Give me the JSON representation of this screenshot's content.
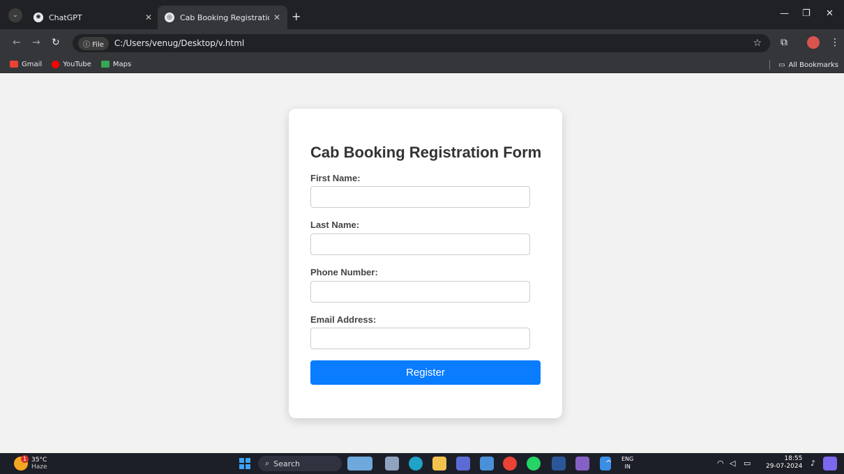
{
  "browser": {
    "tabs": [
      {
        "title": "ChatGPT",
        "favicon": "chatgpt-icon",
        "active": false
      },
      {
        "title": "Cab Booking Registration Form",
        "favicon": "globe-icon",
        "active": true
      }
    ],
    "file_chip": "File",
    "url": "C:/Users/venug/Desktop/v.html",
    "bookmarks": [
      {
        "label": "Gmail",
        "icon": "gmail-icon"
      },
      {
        "label": "YouTube",
        "icon": "youtube-icon"
      },
      {
        "label": "Maps",
        "icon": "maps-icon"
      }
    ],
    "all_bookmarks": "All Bookmarks"
  },
  "form": {
    "title": "Cab Booking Registration Form",
    "fields": [
      {
        "label": "First Name:",
        "value": ""
      },
      {
        "label": "Last Name:",
        "value": ""
      },
      {
        "label": "Phone Number:",
        "value": ""
      },
      {
        "label": "Email Address:",
        "value": ""
      }
    ],
    "submit_label": "Register",
    "accent": "#0a7cff"
  },
  "taskbar": {
    "weather_temp": "35°C",
    "weather_desc": "Haze",
    "weather_badge": "1",
    "search_label": "Search",
    "lang_top": "ENG",
    "lang_bottom": "IN",
    "time": "18:55",
    "date": "29-07-2024"
  }
}
